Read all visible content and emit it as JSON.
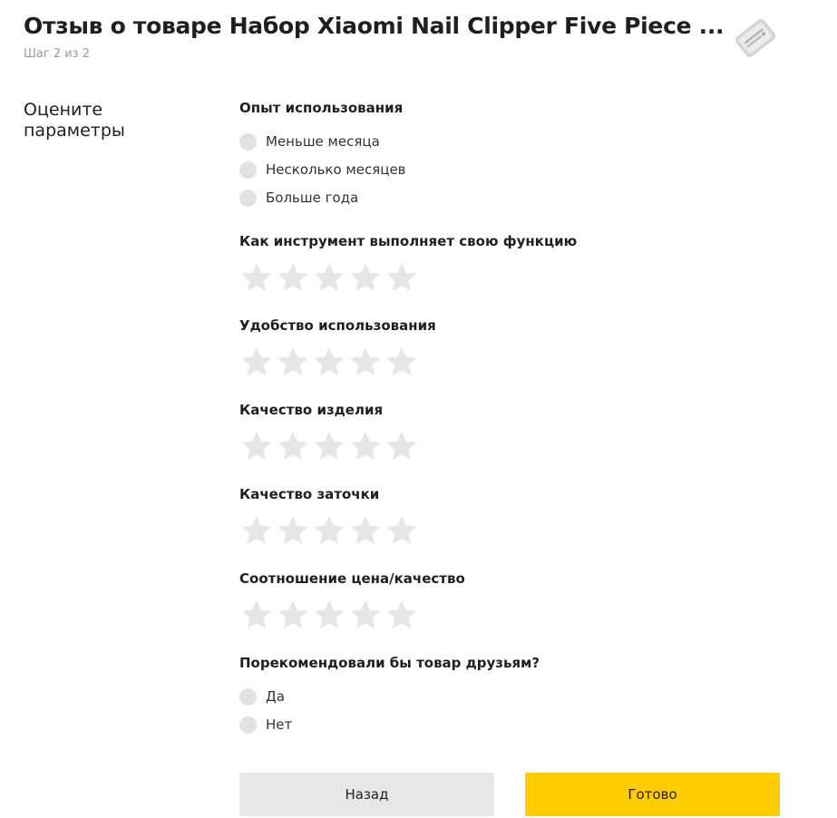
{
  "header": {
    "title": "Отзыв о товаре Набор Xiaomi Nail Clipper Five Piece ...",
    "step": "Шаг 2 из 2"
  },
  "section_label": "Оцените параметры",
  "questions": {
    "experience": {
      "title": "Опыт использования",
      "options": [
        "Меньше месяца",
        "Несколько месяцев",
        "Больше года"
      ]
    },
    "function": {
      "title": "Как инструмент выполняет свою функцию",
      "rating": 0,
      "max": 5
    },
    "usability": {
      "title": "Удобство использования",
      "rating": 0,
      "max": 5
    },
    "quality": {
      "title": "Качество изделия",
      "rating": 0,
      "max": 5
    },
    "sharpening": {
      "title": "Качество заточки",
      "rating": 0,
      "max": 5
    },
    "price_quality": {
      "title": "Соотношение цена/качество",
      "rating": 0,
      "max": 5
    },
    "recommend": {
      "title": "Порекомендовали бы товар друзьям?",
      "options": [
        "Да",
        "Нет"
      ]
    }
  },
  "buttons": {
    "back": "Назад",
    "done": "Готово"
  },
  "colors": {
    "accent": "#ffcc00",
    "secondary_button": "#e7e7e7",
    "star_empty": "#e6e6e6",
    "radio_empty": "#e2e2e2"
  },
  "icons": {
    "star": "star-icon",
    "product": "product-thumbnail"
  }
}
